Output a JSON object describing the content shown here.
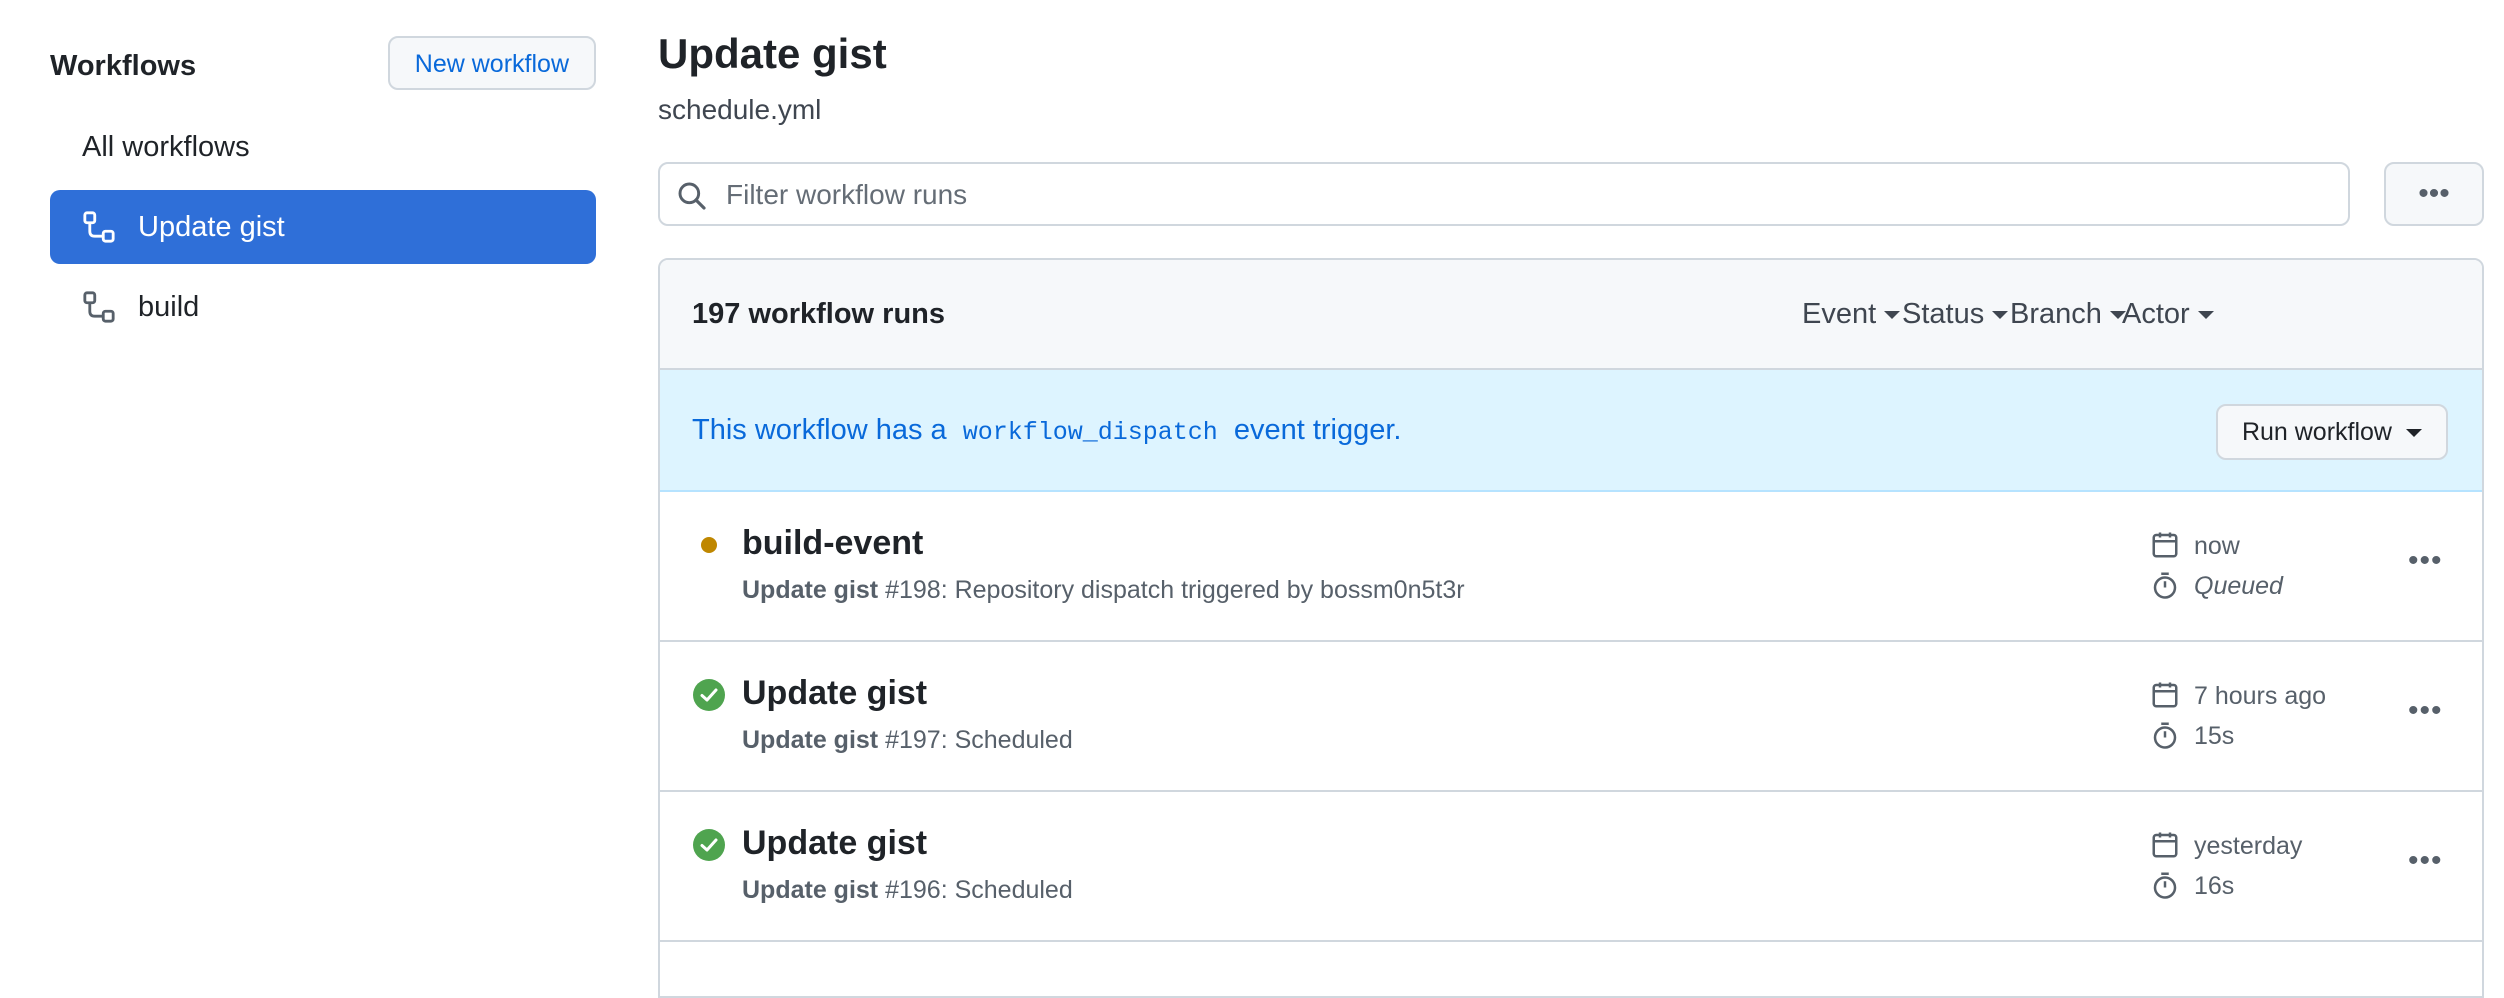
{
  "sidebar": {
    "title": "Workflows",
    "new_workflow_label": "New workflow",
    "items": [
      {
        "label": "All workflows",
        "icon": null,
        "active": false
      },
      {
        "label": "Update gist",
        "icon": "workflow-icon",
        "active": true
      },
      {
        "label": "build",
        "icon": "workflow-icon",
        "active": false
      }
    ]
  },
  "header": {
    "title": "Update gist",
    "file": "schedule.yml"
  },
  "search": {
    "placeholder": "Filter workflow runs",
    "value": ""
  },
  "runs": {
    "count_label": "197 workflow runs",
    "filters": [
      "Event",
      "Status",
      "Branch",
      "Actor"
    ],
    "banner": {
      "prefix": "This workflow has a",
      "code": "workflow_dispatch",
      "suffix": "event trigger.",
      "button": "Run workflow"
    },
    "items": [
      {
        "title": "build-event",
        "status": "queued",
        "workflow": "Update gist",
        "detail": "#198: Repository dispatch triggered by bossm0n5t3r",
        "when": "now",
        "duration": "Queued"
      },
      {
        "title": "Update gist",
        "status": "success",
        "workflow": "Update gist",
        "detail": "#197: Scheduled",
        "when": "7 hours ago",
        "duration": "15s"
      },
      {
        "title": "Update gist",
        "status": "success",
        "workflow": "Update gist",
        "detail": "#196: Scheduled",
        "when": "yesterday",
        "duration": "16s"
      }
    ]
  },
  "colors": {
    "accent": "#0969da",
    "active_bg": "#2f6fd8",
    "success": "#4fa44f",
    "queued": "#bf8700",
    "banner_bg": "#ddf4ff"
  }
}
